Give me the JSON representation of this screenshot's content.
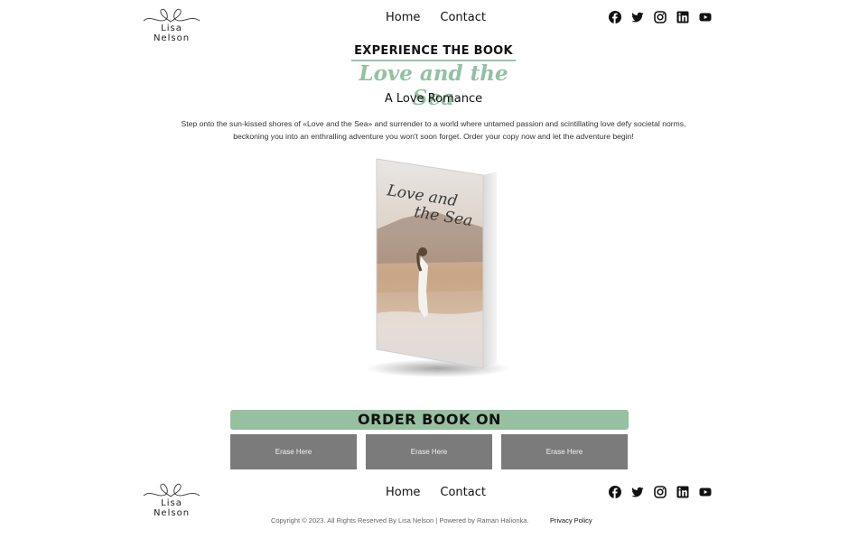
{
  "header": {
    "logo_text": "Lisa Nelson",
    "nav": [
      {
        "label": "Home"
      },
      {
        "label": "Contact"
      }
    ],
    "socials": [
      "facebook-icon",
      "twitter-icon",
      "instagram-icon",
      "linkedin-icon",
      "youtube-icon"
    ]
  },
  "hero": {
    "eyebrow": "EXPERIENCE THE BOOK",
    "title": "Love and the Sea",
    "subtitle": "A Love Romance",
    "description": "Step onto the sun-kissed shores of «Love and the Sea» and surrender to a world where untamed passion and scintillating love defy societal norms, beckoning you into an enthralling adventure you won't soon forget. Order your copy now and let the adventure begin!",
    "book_cover_title_line1": "Love and",
    "book_cover_title_line2": "the Sea"
  },
  "order": {
    "banner": "ORDER BOOK ON",
    "buttons": [
      {
        "label": "Erase Here"
      },
      {
        "label": "Erase Here"
      },
      {
        "label": "Erase Here"
      }
    ]
  },
  "footer": {
    "logo_text": "Lisa Nelson",
    "nav": [
      {
        "label": "Home"
      },
      {
        "label": "Contact"
      }
    ],
    "copyright": "Copyright © 2023. All Rights Reserved By Lisa Nelson | Powered by Raman Halionka.",
    "privacy": "Privacy Policy"
  },
  "colors": {
    "accent": "#97c0a0",
    "button": "#7b7b7b"
  }
}
